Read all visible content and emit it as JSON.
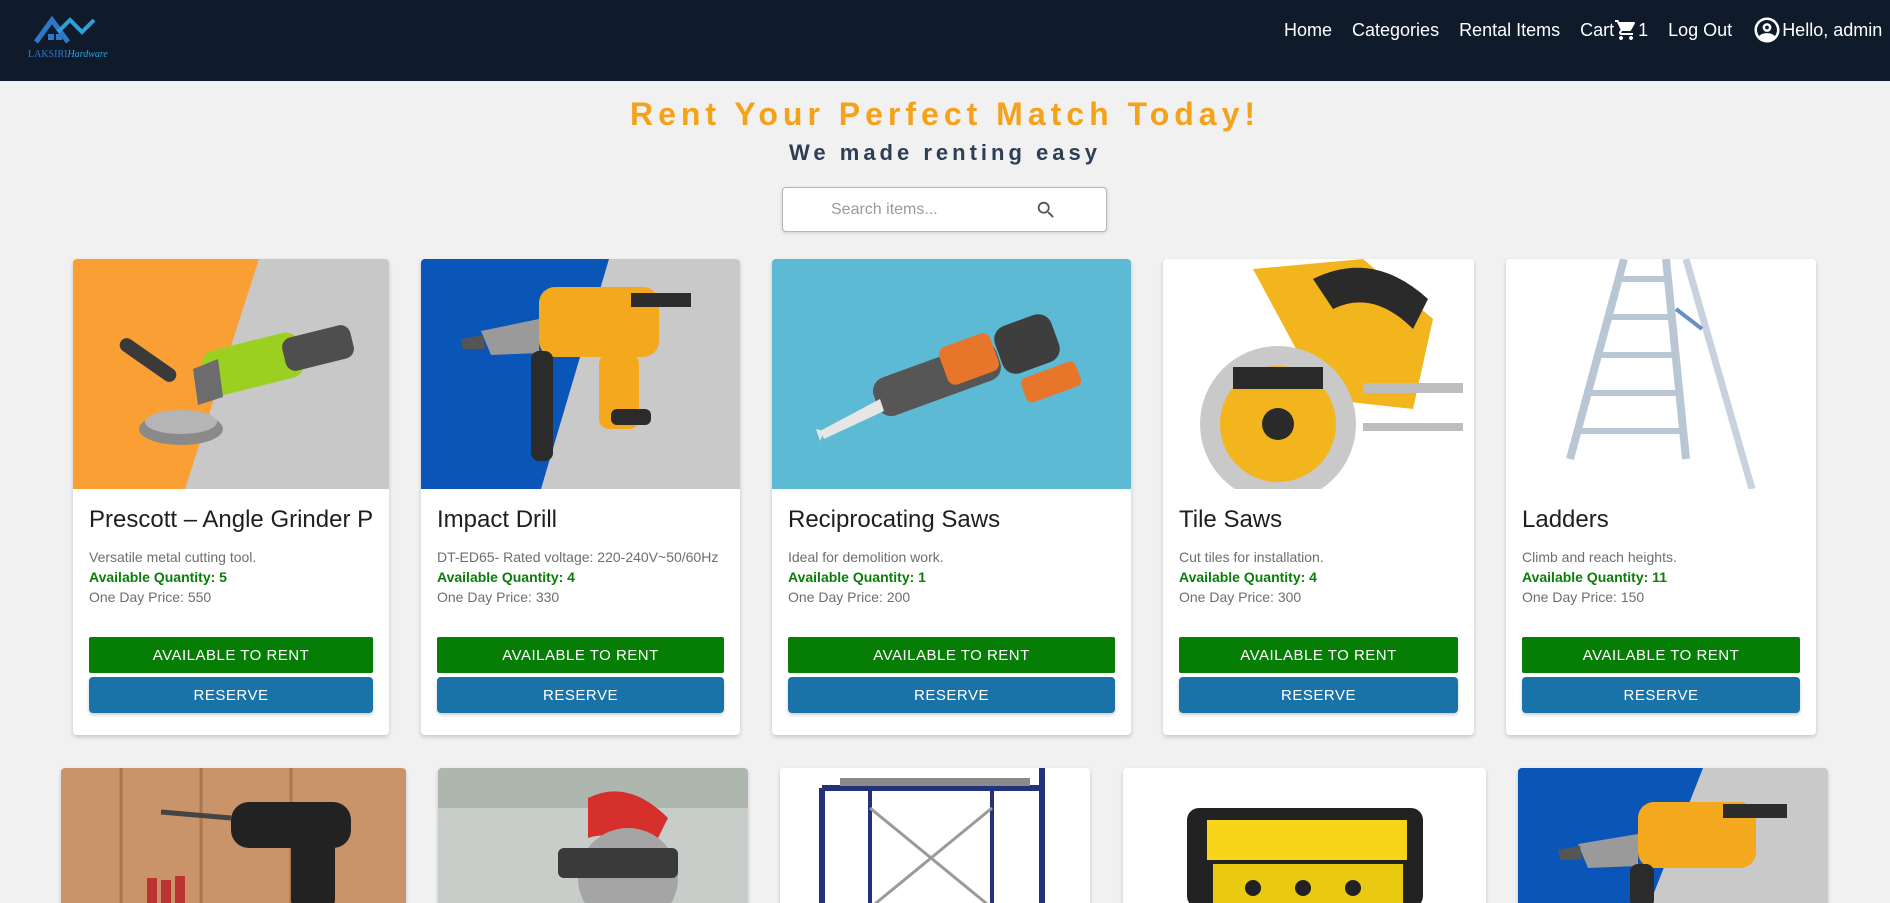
{
  "brand": {
    "logo_word1": "LAKSIRI",
    "logo_word2": "Hardware"
  },
  "nav": {
    "home": "Home",
    "categories": "Categories",
    "rental_items": "Rental Items",
    "cart": "Cart",
    "cart_count": "1",
    "logout": "Log Out",
    "greeting": "Hello, admin"
  },
  "hero": {
    "title": "Rent Your Perfect Match Today!",
    "subtitle": "We made renting easy"
  },
  "search": {
    "placeholder": "Search items..."
  },
  "items": [
    {
      "name": "Prescott – Angle Grinder P",
      "description": "Versatile metal cutting tool.",
      "quantity": "Available Quantity: 5",
      "price": "One Day Price: 550",
      "status": "AVAILABLE TO RENT",
      "action": "RESERVE",
      "image": "angle-grinder"
    },
    {
      "name": "Impact Drill",
      "description": "DT-ED65- Rated voltage: 220-240V~50/60Hz",
      "quantity": "Available Quantity: 4",
      "price": "One Day Price: 330",
      "status": "AVAILABLE TO RENT",
      "action": "RESERVE",
      "image": "impact-drill"
    },
    {
      "name": "Reciprocating Saws",
      "description": "Ideal for demolition work.",
      "quantity": "Available Quantity: 1",
      "price": "One Day Price: 200",
      "status": "AVAILABLE TO RENT",
      "action": "RESERVE",
      "image": "reciprocating-saw"
    },
    {
      "name": "Tile Saws",
      "description": "Cut tiles for installation.",
      "quantity": "Available Quantity: 4",
      "price": "One Day Price: 300",
      "status": "AVAILABLE TO RENT",
      "action": "RESERVE",
      "image": "tile-saw"
    },
    {
      "name": "Ladders",
      "description": "Climb and reach heights.",
      "quantity": "Available Quantity: 11",
      "price": "One Day Price: 150",
      "status": "AVAILABLE TO RENT",
      "action": "RESERVE",
      "image": "ladder"
    }
  ],
  "row2_images": [
    "cordless-drill",
    "circular-saw",
    "scaffolding",
    "generator",
    "impact-drill"
  ],
  "colors": {
    "navbar": "#0f1a2a",
    "accent": "#f5a21b",
    "available": "#067e06",
    "reserve": "#1a73a8"
  }
}
